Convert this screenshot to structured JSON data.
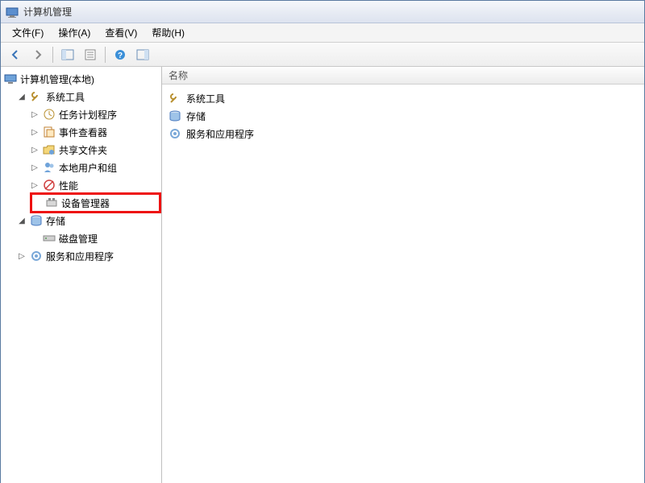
{
  "window": {
    "title": "计算机管理"
  },
  "menu": {
    "file": "文件(F)",
    "action": "操作(A)",
    "view": "查看(V)",
    "help": "帮助(H)"
  },
  "tree": {
    "root": "计算机管理(本地)",
    "system_tools": "系统工具",
    "task_scheduler": "任务计划程序",
    "event_viewer": "事件查看器",
    "shared_folders": "共享文件夹",
    "local_users": "本地用户和组",
    "performance": "性能",
    "device_manager": "设备管理器",
    "storage": "存储",
    "disk_mgmt": "磁盘管理",
    "services_apps": "服务和应用程序"
  },
  "right_panel": {
    "column_name": "名称",
    "items": {
      "system_tools": "系统工具",
      "storage": "存储",
      "services_apps": "服务和应用程序"
    }
  }
}
